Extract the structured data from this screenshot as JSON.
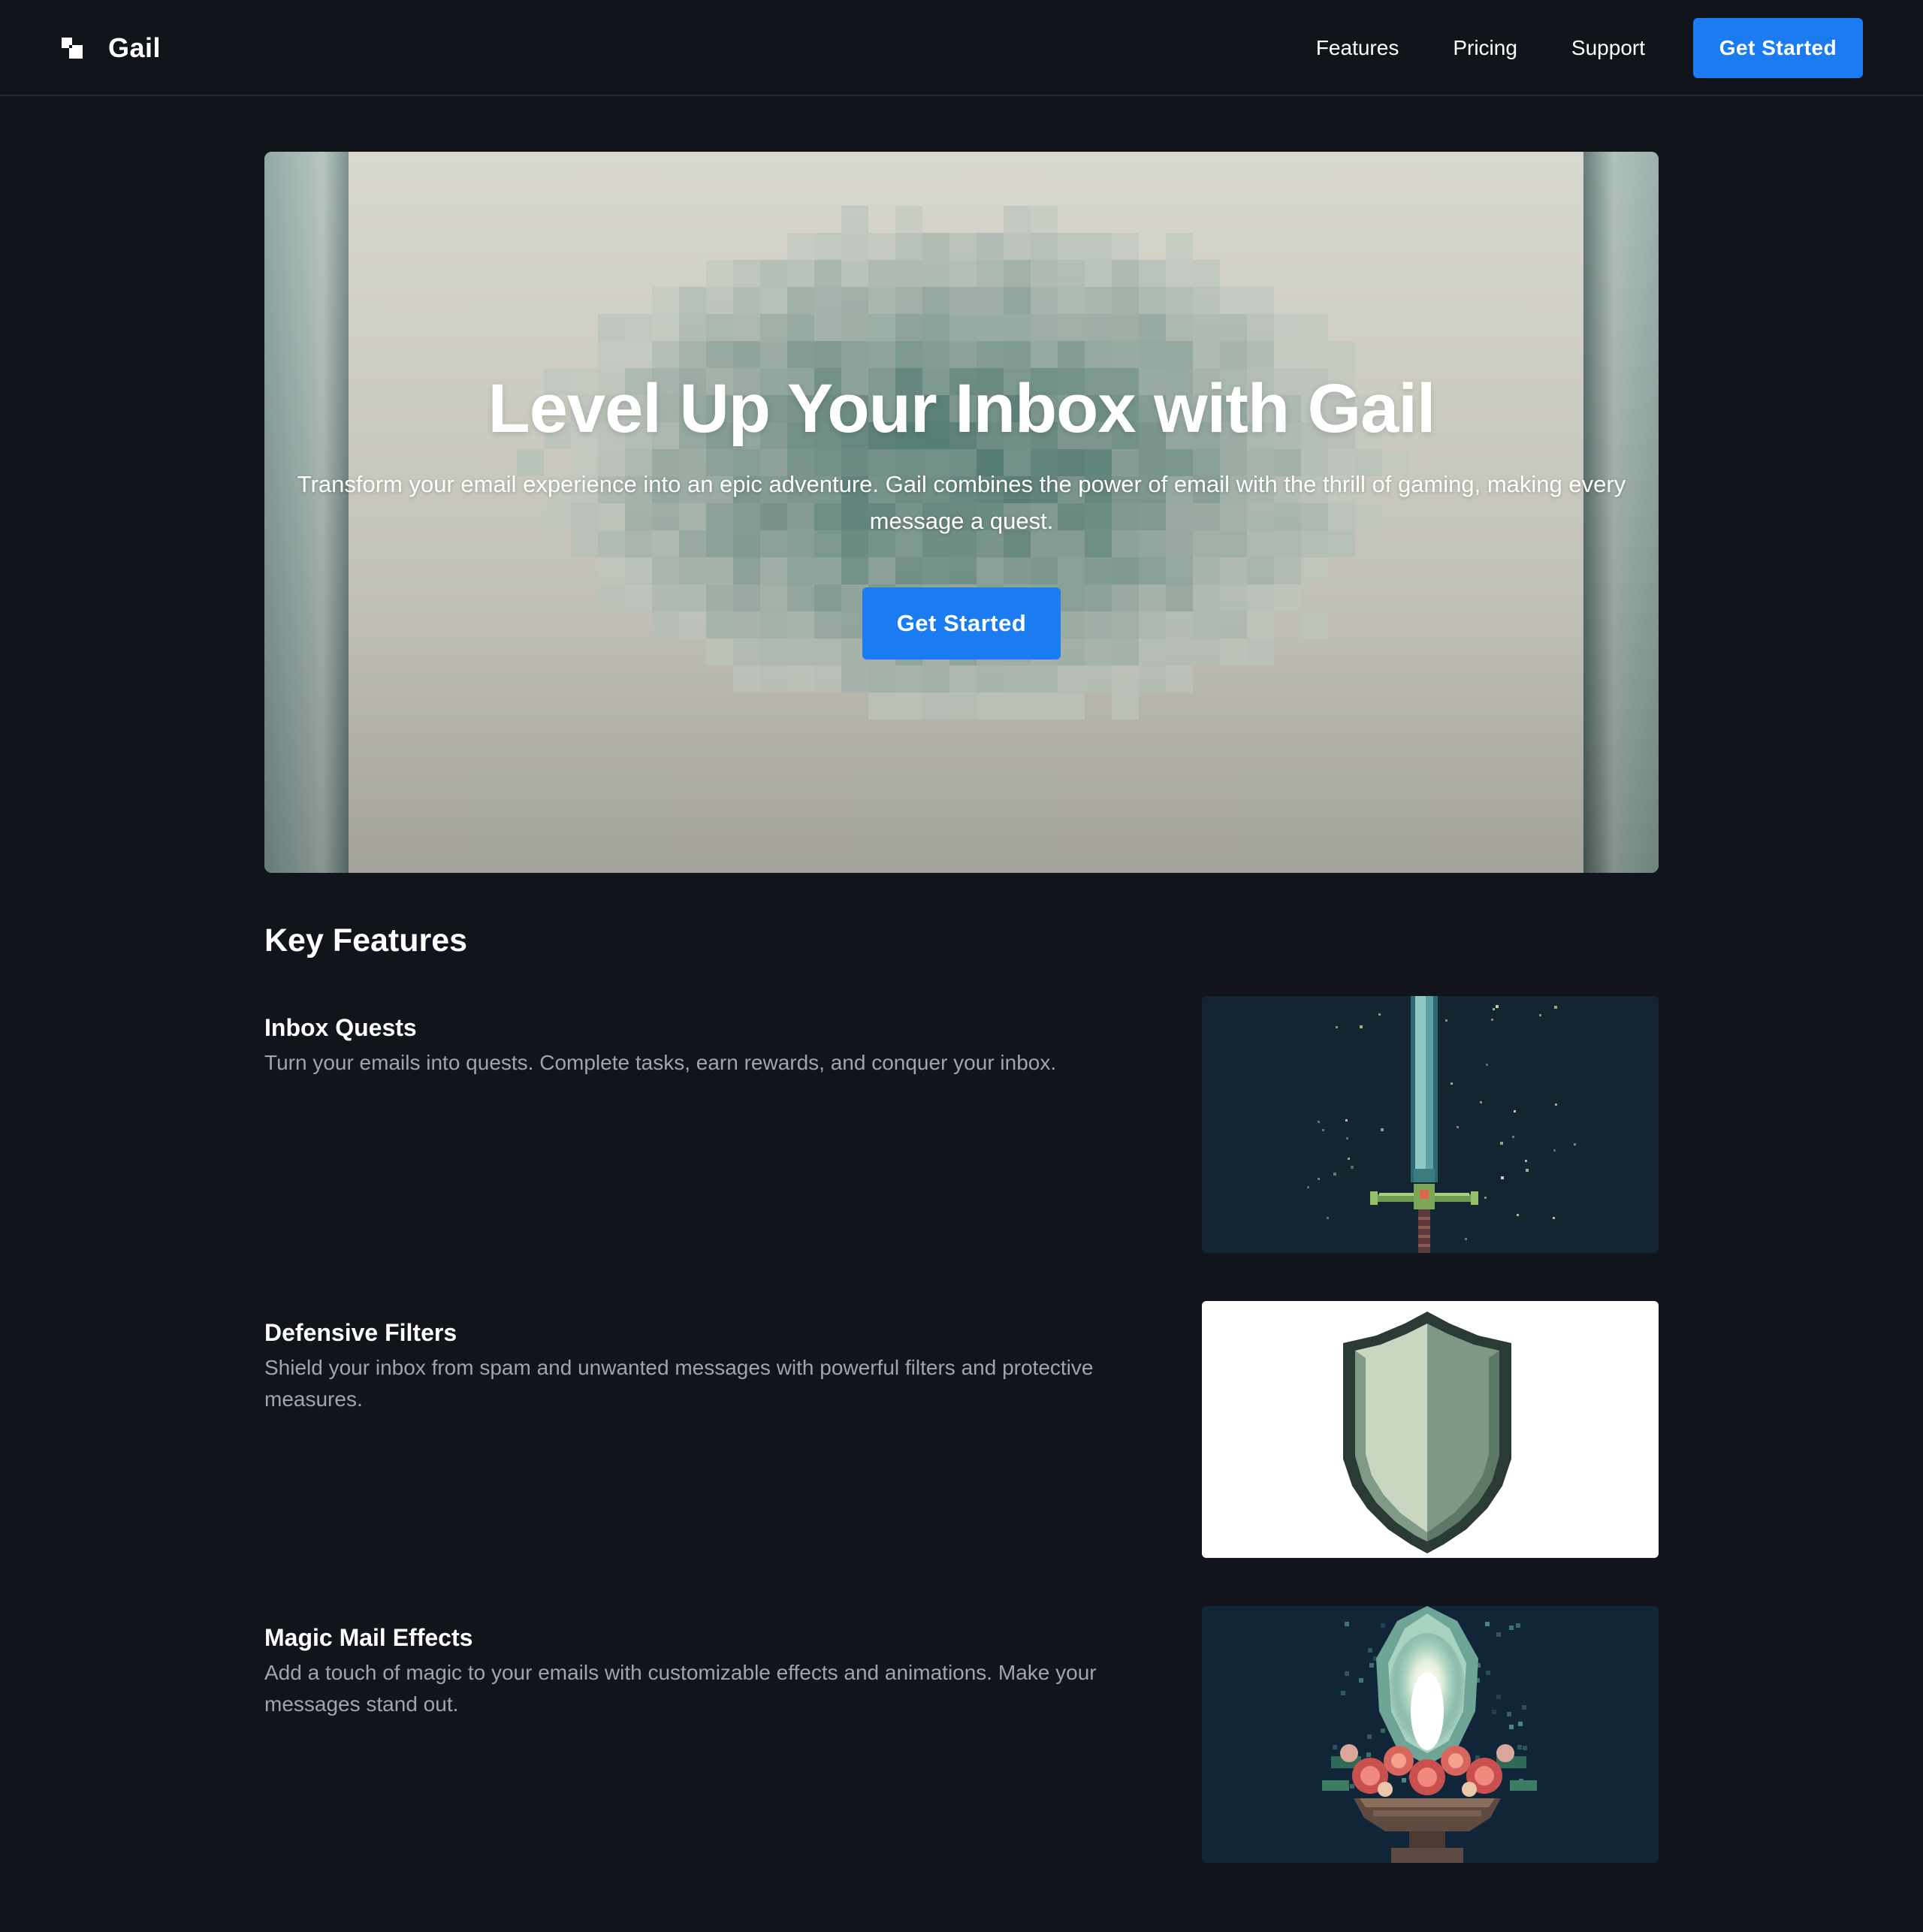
{
  "header": {
    "brand_name": "Gail",
    "nav": [
      {
        "label": "Features"
      },
      {
        "label": "Pricing"
      },
      {
        "label": "Support"
      }
    ],
    "cta_label": "Get Started"
  },
  "hero": {
    "title": "Level Up Your Inbox with Gail",
    "subtitle": "Transform your email experience into an epic adventure. Gail combines the power of email with the thrill of gaming, making every message a quest.",
    "cta_label": "Get Started",
    "image_icon": "pixel-scroll-image"
  },
  "features": {
    "title": "Key Features",
    "items": [
      {
        "title": "Inbox Quests",
        "description": "Turn your emails into quests. Complete tasks, earn rewards, and conquer your inbox.",
        "image_icon": "pixel-sword-image"
      },
      {
        "title": "Defensive Filters",
        "description": "Shield your inbox from spam and unwanted messages with powerful filters and protective measures.",
        "image_icon": "pixel-shield-image"
      },
      {
        "title": "Magic Mail Effects",
        "description": "Add a touch of magic to your emails with customizable effects and animations. Make your messages stand out.",
        "image_icon": "pixel-magic-brazier-image"
      }
    ]
  },
  "colors": {
    "background": "#11141a",
    "accent": "#1a7cf0",
    "muted_text": "#a0a4ab"
  }
}
